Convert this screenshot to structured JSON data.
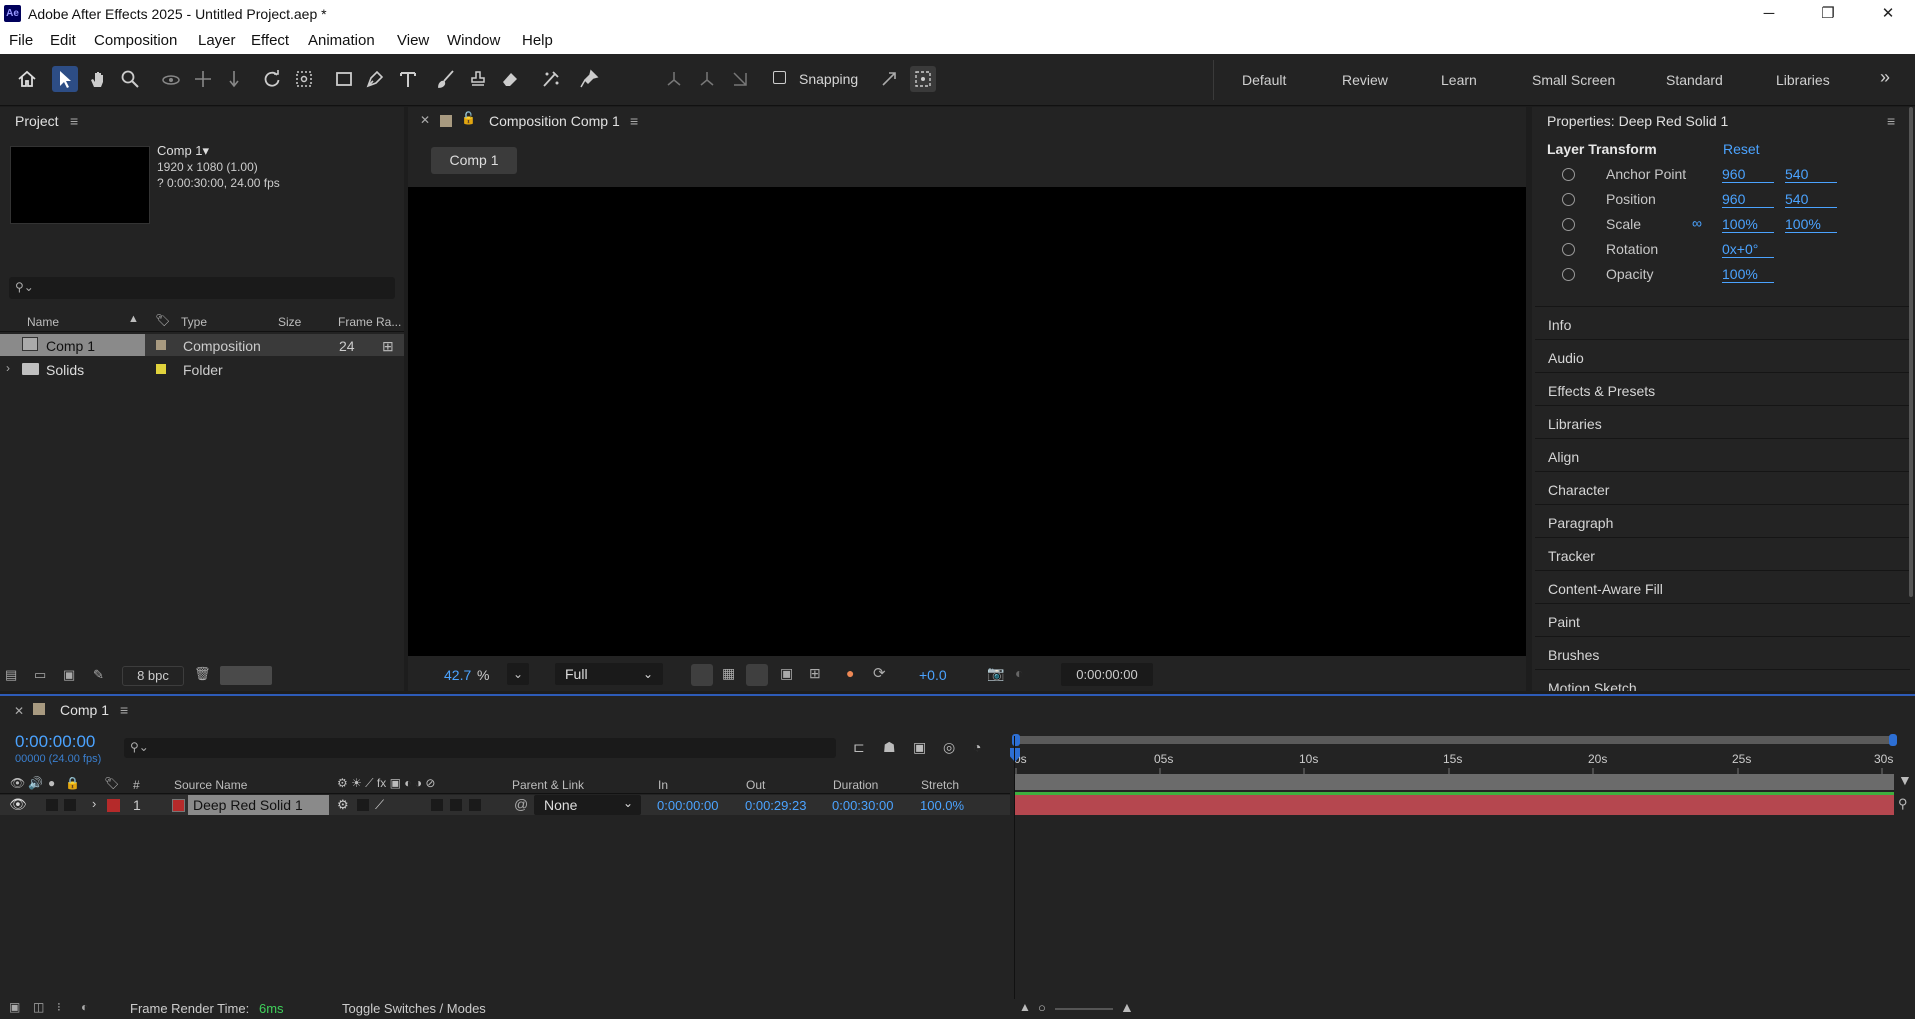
{
  "app": {
    "logo": "Ae",
    "title": "Adobe After Effects 2025 - Untitled Project.aep *"
  },
  "window_controls": {
    "minimize": "─",
    "maximize": "❐",
    "close": "✕"
  },
  "menu": [
    "File",
    "Edit",
    "Composition",
    "Layer",
    "Effect",
    "Animation",
    "View",
    "Window",
    "Help"
  ],
  "toolbar": {
    "snapping_label": "Snapping",
    "workspaces": [
      "Default",
      "Review",
      "Learn",
      "Small Screen",
      "Standard",
      "Libraries"
    ],
    "more": "»"
  },
  "project": {
    "tab": "Project",
    "comp_name": "Comp 1▾",
    "comp_res": "1920 x 1080 (1.00)",
    "comp_dur": "? 0:00:30:00, 24.00 fps",
    "search_placeholder": "",
    "columns": [
      "Name",
      "Type",
      "Size",
      "Frame Ra..."
    ],
    "items": [
      {
        "name": "Comp 1",
        "type": "Composition",
        "size": "",
        "fps": "24",
        "label_color": "#a89a80"
      },
      {
        "name": "Solids",
        "type": "Folder",
        "size": "",
        "fps": "",
        "label_color": "#e0d23c"
      }
    ],
    "bpc": "8 bpc"
  },
  "composition": {
    "tab": "Composition Comp 1",
    "breadcrumb": "Comp 1",
    "zoom": "42.7",
    "zoom_unit": "%",
    "resolution": "Full",
    "exposure": "+0.0",
    "timecode": "0:00:00:00"
  },
  "properties": {
    "title": "Properties: Deep Red Solid 1",
    "section": "Layer Transform",
    "reset": "Reset",
    "rows": [
      {
        "label": "Anchor Point",
        "v1": "960",
        "v2": "540"
      },
      {
        "label": "Position",
        "v1": "960",
        "v2": "540"
      },
      {
        "label": "Scale",
        "v1": "100%",
        "v2": "100%"
      },
      {
        "label": "Rotation",
        "v1": "0x+0°",
        "v2": ""
      },
      {
        "label": "Opacity",
        "v1": "100%",
        "v2": ""
      }
    ],
    "panels": [
      "Info",
      "Audio",
      "Effects & Presets",
      "Libraries",
      "Align",
      "Character",
      "Paragraph",
      "Tracker",
      "Content-Aware Fill",
      "Paint",
      "Brushes",
      "Motion Sketch"
    ]
  },
  "timeline": {
    "tab": "Comp 1",
    "timecode": "0:00:00:00",
    "frame_info": "00000 (24.00 fps)",
    "columns": {
      "num": "#",
      "source": "Source Name",
      "parent": "Parent & Link",
      "in": "In",
      "out": "Out",
      "duration": "Duration",
      "stretch": "Stretch"
    },
    "ruler": [
      "0s",
      "05s",
      "10s",
      "15s",
      "20s",
      "25s",
      "30s"
    ],
    "layers": [
      {
        "num": "1",
        "name": "Deep Red Solid 1",
        "color": "#b52a2a",
        "parent": "None",
        "in": "0:00:00:00",
        "out": "0:00:29:23",
        "duration": "0:00:30:00",
        "stretch": "100.0%"
      }
    ],
    "footer": {
      "render_label": "Frame Render Time:",
      "render_value": "6ms",
      "toggle": "Toggle Switches / Modes"
    }
  },
  "colors": {
    "accent": "#4ba3ff",
    "layer_bar": "#b5474f",
    "work_area": "#3fae3f"
  }
}
